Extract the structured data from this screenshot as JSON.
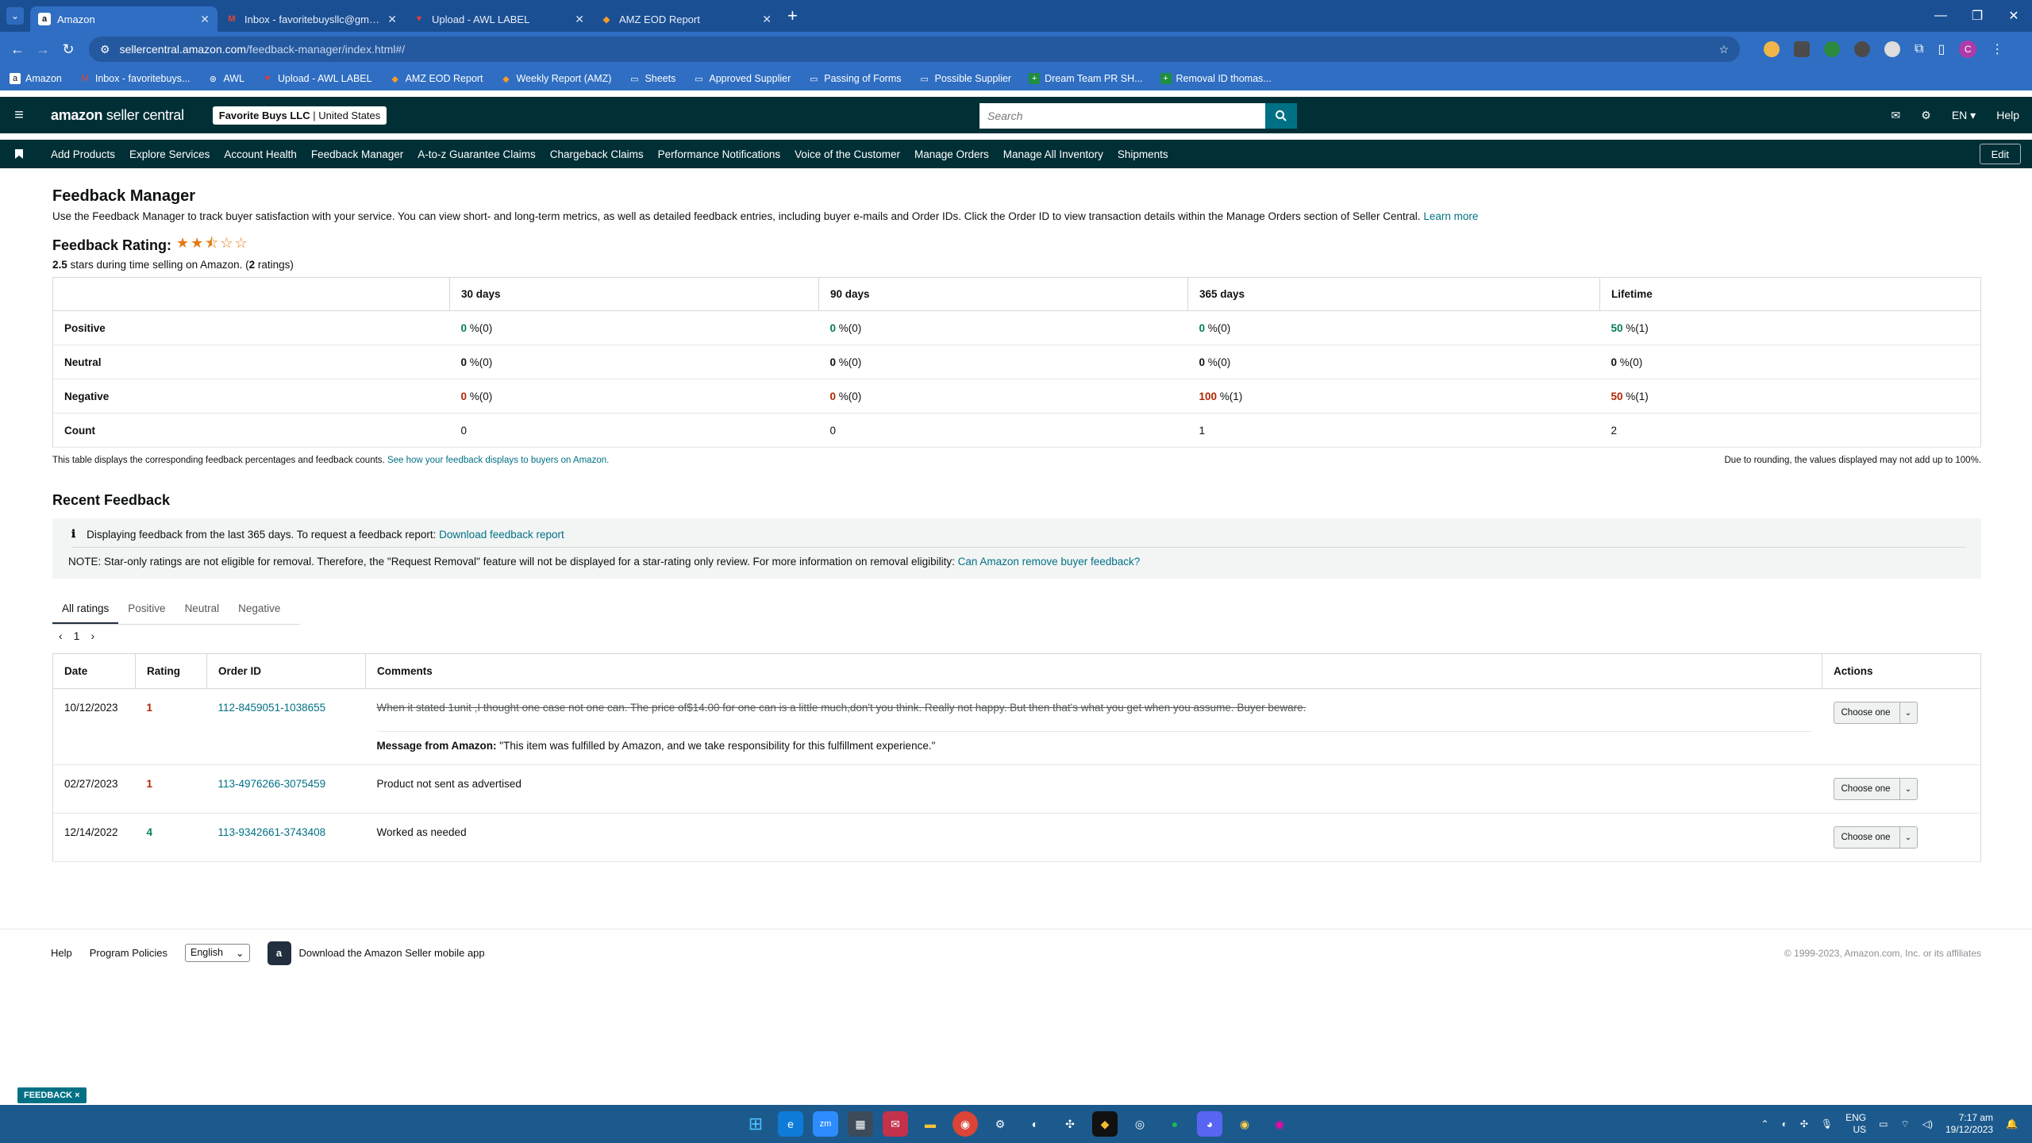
{
  "browser": {
    "tabs": [
      {
        "label": "Amazon",
        "icon": "amazon-favicon",
        "active": true
      },
      {
        "label": "Inbox - favoritebuysllc@gmail.c",
        "icon": "gmail-favicon",
        "active": false
      },
      {
        "label": "Upload - AWL LABEL",
        "icon": "awl-favicon",
        "active": false
      },
      {
        "label": "AMZ EOD Report",
        "icon": "report-favicon",
        "active": false
      }
    ],
    "url_host": "sellercentral.amazon.com",
    "url_path": "/feedback-manager/index.html#/",
    "bookmarks": [
      "Amazon",
      "Inbox - favoritebuys...",
      "AWL",
      "Upload - AWL LABEL",
      "AMZ EOD Report",
      "Weekly Report (AMZ)",
      "Sheets",
      "Approved Supplier",
      "Passing of Forms",
      "Possible Supplier",
      "Dream Team PR SH...",
      "Removal ID thomas..."
    ],
    "profile_initial": "C"
  },
  "header": {
    "logo_main": "amazon",
    "logo_sub": "seller central",
    "store_name": "Favorite Buys LLC",
    "store_region": "United States",
    "search_placeholder": "Search",
    "lang": "EN",
    "help": "Help"
  },
  "nav": {
    "links": [
      "Add Products",
      "Explore Services",
      "Account Health",
      "Feedback Manager",
      "A-to-z Guarantee Claims",
      "Chargeback Claims",
      "Performance Notifications",
      "Voice of the Customer",
      "Manage Orders",
      "Manage All Inventory",
      "Shipments"
    ],
    "edit": "Edit"
  },
  "page": {
    "title": "Feedback Manager",
    "intro": "Use the Feedback Manager to track buyer satisfaction with your service. You can view short- and long-term metrics, as well as detailed feedback entries, including buyer e-mails and Order IDs. Click the Order ID to view transaction details within the Manage Orders section of Seller Central.",
    "learn_more": "Learn more",
    "rating_label": "Feedback Rating:",
    "stars_value": 2.5,
    "stars_text": "★★⯪☆☆",
    "rating_value": "2.5",
    "rating_mid": " stars during time selling on Amazon. (",
    "rating_count": "2",
    "rating_end": " ratings)"
  },
  "metrics": {
    "columns": [
      "30 days",
      "90 days",
      "365 days",
      "Lifetime"
    ],
    "rows": [
      {
        "label": "Positive",
        "values": [
          "0",
          "0",
          "0",
          "50"
        ],
        "counts": [
          "%(0)",
          "%(0)",
          "%(0)",
          "%(1)"
        ]
      },
      {
        "label": "Neutral",
        "values": [
          "0",
          "0",
          "0",
          "0"
        ],
        "counts": [
          "%(0)",
          "%(0)",
          "%(0)",
          "%(0)"
        ]
      },
      {
        "label": "Negative",
        "values": [
          "0",
          "0",
          "100",
          "50"
        ],
        "counts": [
          "%(0)",
          "%(0)",
          "%(1)",
          "%(1)"
        ]
      },
      {
        "label": "Count",
        "values": [
          "0",
          "0",
          "1",
          "2"
        ]
      }
    ],
    "footnote": "This table displays the corresponding feedback percentages and feedback counts.",
    "footnote_link": "See how your feedback displays to buyers on Amazon.",
    "rounding_note": "Due to rounding, the values displayed may not add up to 100%."
  },
  "recent": {
    "title": "Recent Feedback",
    "info": "Displaying feedback from the last 365 days. To request a feedback report:",
    "info_link": "Download feedback report",
    "note": "NOTE: Star-only ratings are not eligible for removal. Therefore, the \"Request Removal\" feature will not be displayed for a star-rating only review. For more information on removal eligibility:",
    "note_link": "Can Amazon remove buyer feedback?",
    "tabs": [
      "All ratings",
      "Positive",
      "Neutral",
      "Negative"
    ],
    "page": "1",
    "headers": [
      "Date",
      "Rating",
      "Order ID",
      "Comments",
      "Actions"
    ],
    "rows": [
      {
        "date": "10/12/2023",
        "rating": "1",
        "order": "112-8459051-1038655",
        "comment": "When it stated 1unit ,I thought one case not one can. The price of$14.00 for one can is a little much,don't you think. Really not happy. But then that's what you get when you assume. Buyer beware.",
        "struck": true,
        "message_label": "Message from Amazon:",
        "message": "\"This item was fulfilled by Amazon, and we take responsibility for this fulfillment experience.\"",
        "action": "Choose one"
      },
      {
        "date": "02/27/2023",
        "rating": "1",
        "order": "113-4976266-3075459",
        "comment": "Product not sent as advertised",
        "struck": false,
        "action": "Choose one"
      },
      {
        "date": "12/14/2022",
        "rating": "4",
        "order": "113-9342661-3743408",
        "comment": "Worked as needed",
        "struck": false,
        "action": "Choose one"
      }
    ]
  },
  "footer": {
    "help": "Help",
    "policies": "Program Policies",
    "language": "English",
    "app": "Download the Amazon Seller mobile app",
    "copyright": "© 1999-2023, Amazon.com, Inc. or its affiliates"
  },
  "feedback_tab": "FEEDBACK ×",
  "taskbar": {
    "lang": "ENG",
    "region": "US",
    "time": "7:17 am",
    "date": "19/12/2023"
  }
}
